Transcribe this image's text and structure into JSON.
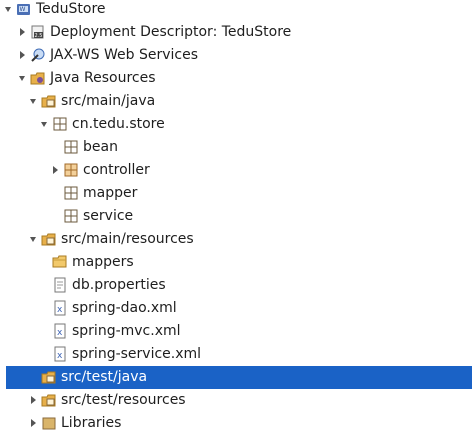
{
  "tree": {
    "project": "TeduStore",
    "deployment_descriptor": "Deployment Descriptor: TeduStore",
    "jaxws": "JAX-WS Web Services",
    "java_resources": "Java Resources",
    "src_main_java": "src/main/java",
    "package_store": "cn.tedu.store",
    "pkg_bean": "bean",
    "pkg_controller": "controller",
    "pkg_mapper": "mapper",
    "pkg_service": "service",
    "src_main_resources": "src/main/resources",
    "folder_mappers": "mappers",
    "file_db_properties": "db.properties",
    "file_spring_dao": "spring-dao.xml",
    "file_spring_mvc": "spring-mvc.xml",
    "file_spring_service": "spring-service.xml",
    "src_test_java": "src/test/java",
    "src_test_resources": "src/test/resources",
    "libraries_partial": "Libraries"
  },
  "colors": {
    "selection": "#1a62c6",
    "folder": "#e8b04a",
    "package": "#8a6a3a",
    "xml": "#3d63b5"
  }
}
